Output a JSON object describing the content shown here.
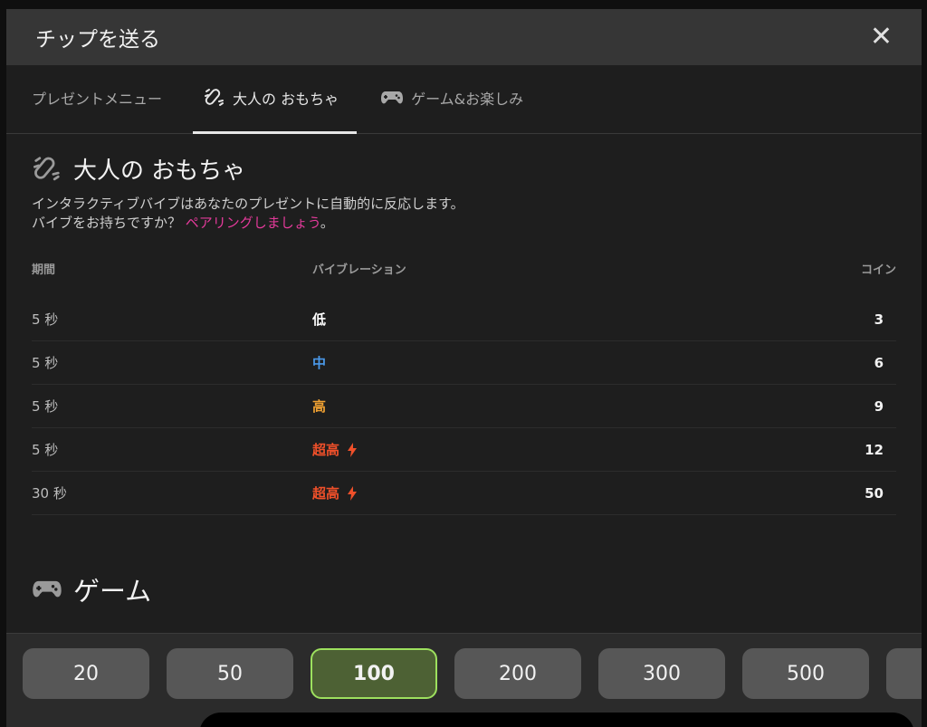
{
  "header": {
    "title": "チップを送る",
    "close_icon": "close-icon"
  },
  "tabs": [
    {
      "label": "プレゼントメニュー",
      "icon": null,
      "active": false
    },
    {
      "label": "大人の おもちゃ",
      "icon": "vibrator-icon",
      "active": true
    },
    {
      "label": "ゲーム&お楽しみ",
      "icon": "gamepad-icon",
      "active": false
    }
  ],
  "toys_section": {
    "title": "大人の おもちゃ",
    "description_line1": "インタラクティブバイブはあなたのプレゼントに自動的に反応します。",
    "description_line2": "バイブをお持ちですか？ ",
    "pair_link": "ペアリングしましょう",
    "after_link": "。"
  },
  "table": {
    "headers": {
      "duration": "期間",
      "vibration": "バイブレーション",
      "coins": "コイン"
    },
    "rows": [
      {
        "duration": "5 秒",
        "level": "低",
        "color": "#ffffff",
        "bolt": false,
        "coins": "3"
      },
      {
        "duration": "5 秒",
        "level": "中",
        "color": "#4a98e8",
        "bolt": false,
        "coins": "6"
      },
      {
        "duration": "5 秒",
        "level": "高",
        "color": "#f0a132",
        "bolt": false,
        "coins": "9"
      },
      {
        "duration": "5 秒",
        "level": "超高",
        "color": "#f0502a",
        "bolt": true,
        "coins": "12"
      },
      {
        "duration": "30 秒",
        "level": "超高",
        "color": "#f0502a",
        "bolt": true,
        "coins": "50"
      }
    ]
  },
  "games_section": {
    "title": "ゲーム"
  },
  "amounts": {
    "options": [
      "20",
      "50",
      "100",
      "200",
      "300",
      "500",
      ""
    ],
    "selected": "100",
    "selected_color": "#9de05e"
  }
}
